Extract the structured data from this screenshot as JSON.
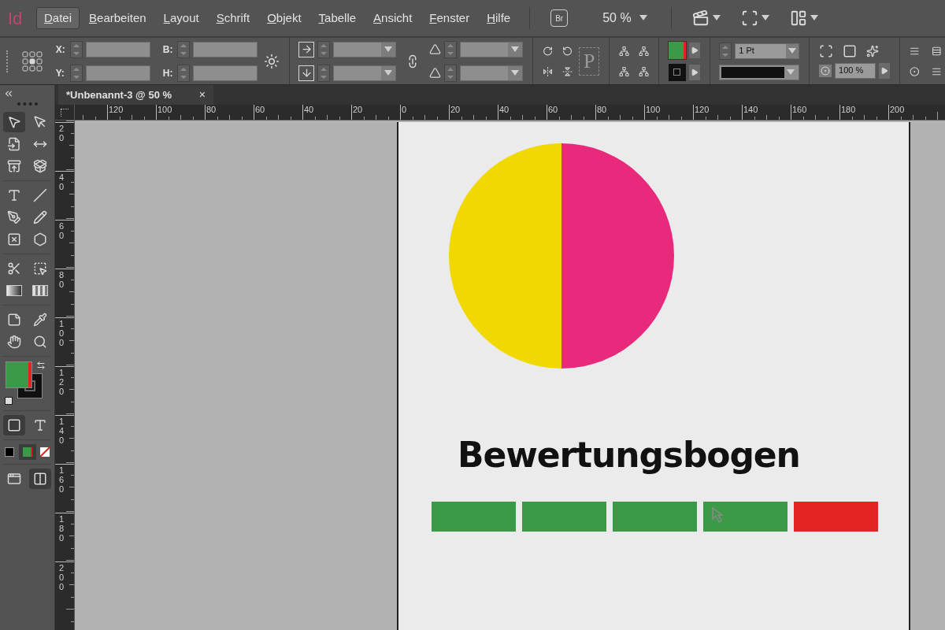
{
  "app_logo": "Id",
  "menu": [
    {
      "label": "Datei",
      "selected": true
    },
    {
      "label": "Bearbeiten",
      "selected": false
    },
    {
      "label": "Layout",
      "selected": false
    },
    {
      "label": "Schrift",
      "selected": false
    },
    {
      "label": "Objekt",
      "selected": false
    },
    {
      "label": "Tabelle",
      "selected": false
    },
    {
      "label": "Ansicht",
      "selected": false
    },
    {
      "label": "Fenster",
      "selected": false
    },
    {
      "label": "Hilfe",
      "selected": false
    }
  ],
  "app_bar": {
    "bridge": "Br",
    "zoom": "50 %"
  },
  "control_panel": {
    "position_labels": [
      "X:",
      "Y:"
    ],
    "size_labels": [
      "B:",
      "H:"
    ],
    "paragraph_glyph": "P",
    "stroke_weight": "1 Pt",
    "opacity": "100 %"
  },
  "document_tab": {
    "title": "*Unbenannt-3 @ 50 %",
    "close": "×"
  },
  "horizontal_ruler": [
    "120",
    "100",
    "80",
    "60",
    "40",
    "20",
    "0",
    "20",
    "40",
    "60",
    "80",
    "100",
    "120",
    "140",
    "160",
    "180",
    "200"
  ],
  "vertical_ruler": [
    "20",
    "40",
    "60",
    "80",
    "100",
    "120",
    "140",
    "160",
    "180",
    "200"
  ],
  "page": {
    "title": "Bewertungsbogen",
    "rating_bars": [
      {
        "color": "#3a9a48"
      },
      {
        "color": "#3a9a48"
      },
      {
        "color": "#3a9a48"
      },
      {
        "color": "#3a9a48"
      },
      {
        "color": "#e42322"
      }
    ]
  }
}
